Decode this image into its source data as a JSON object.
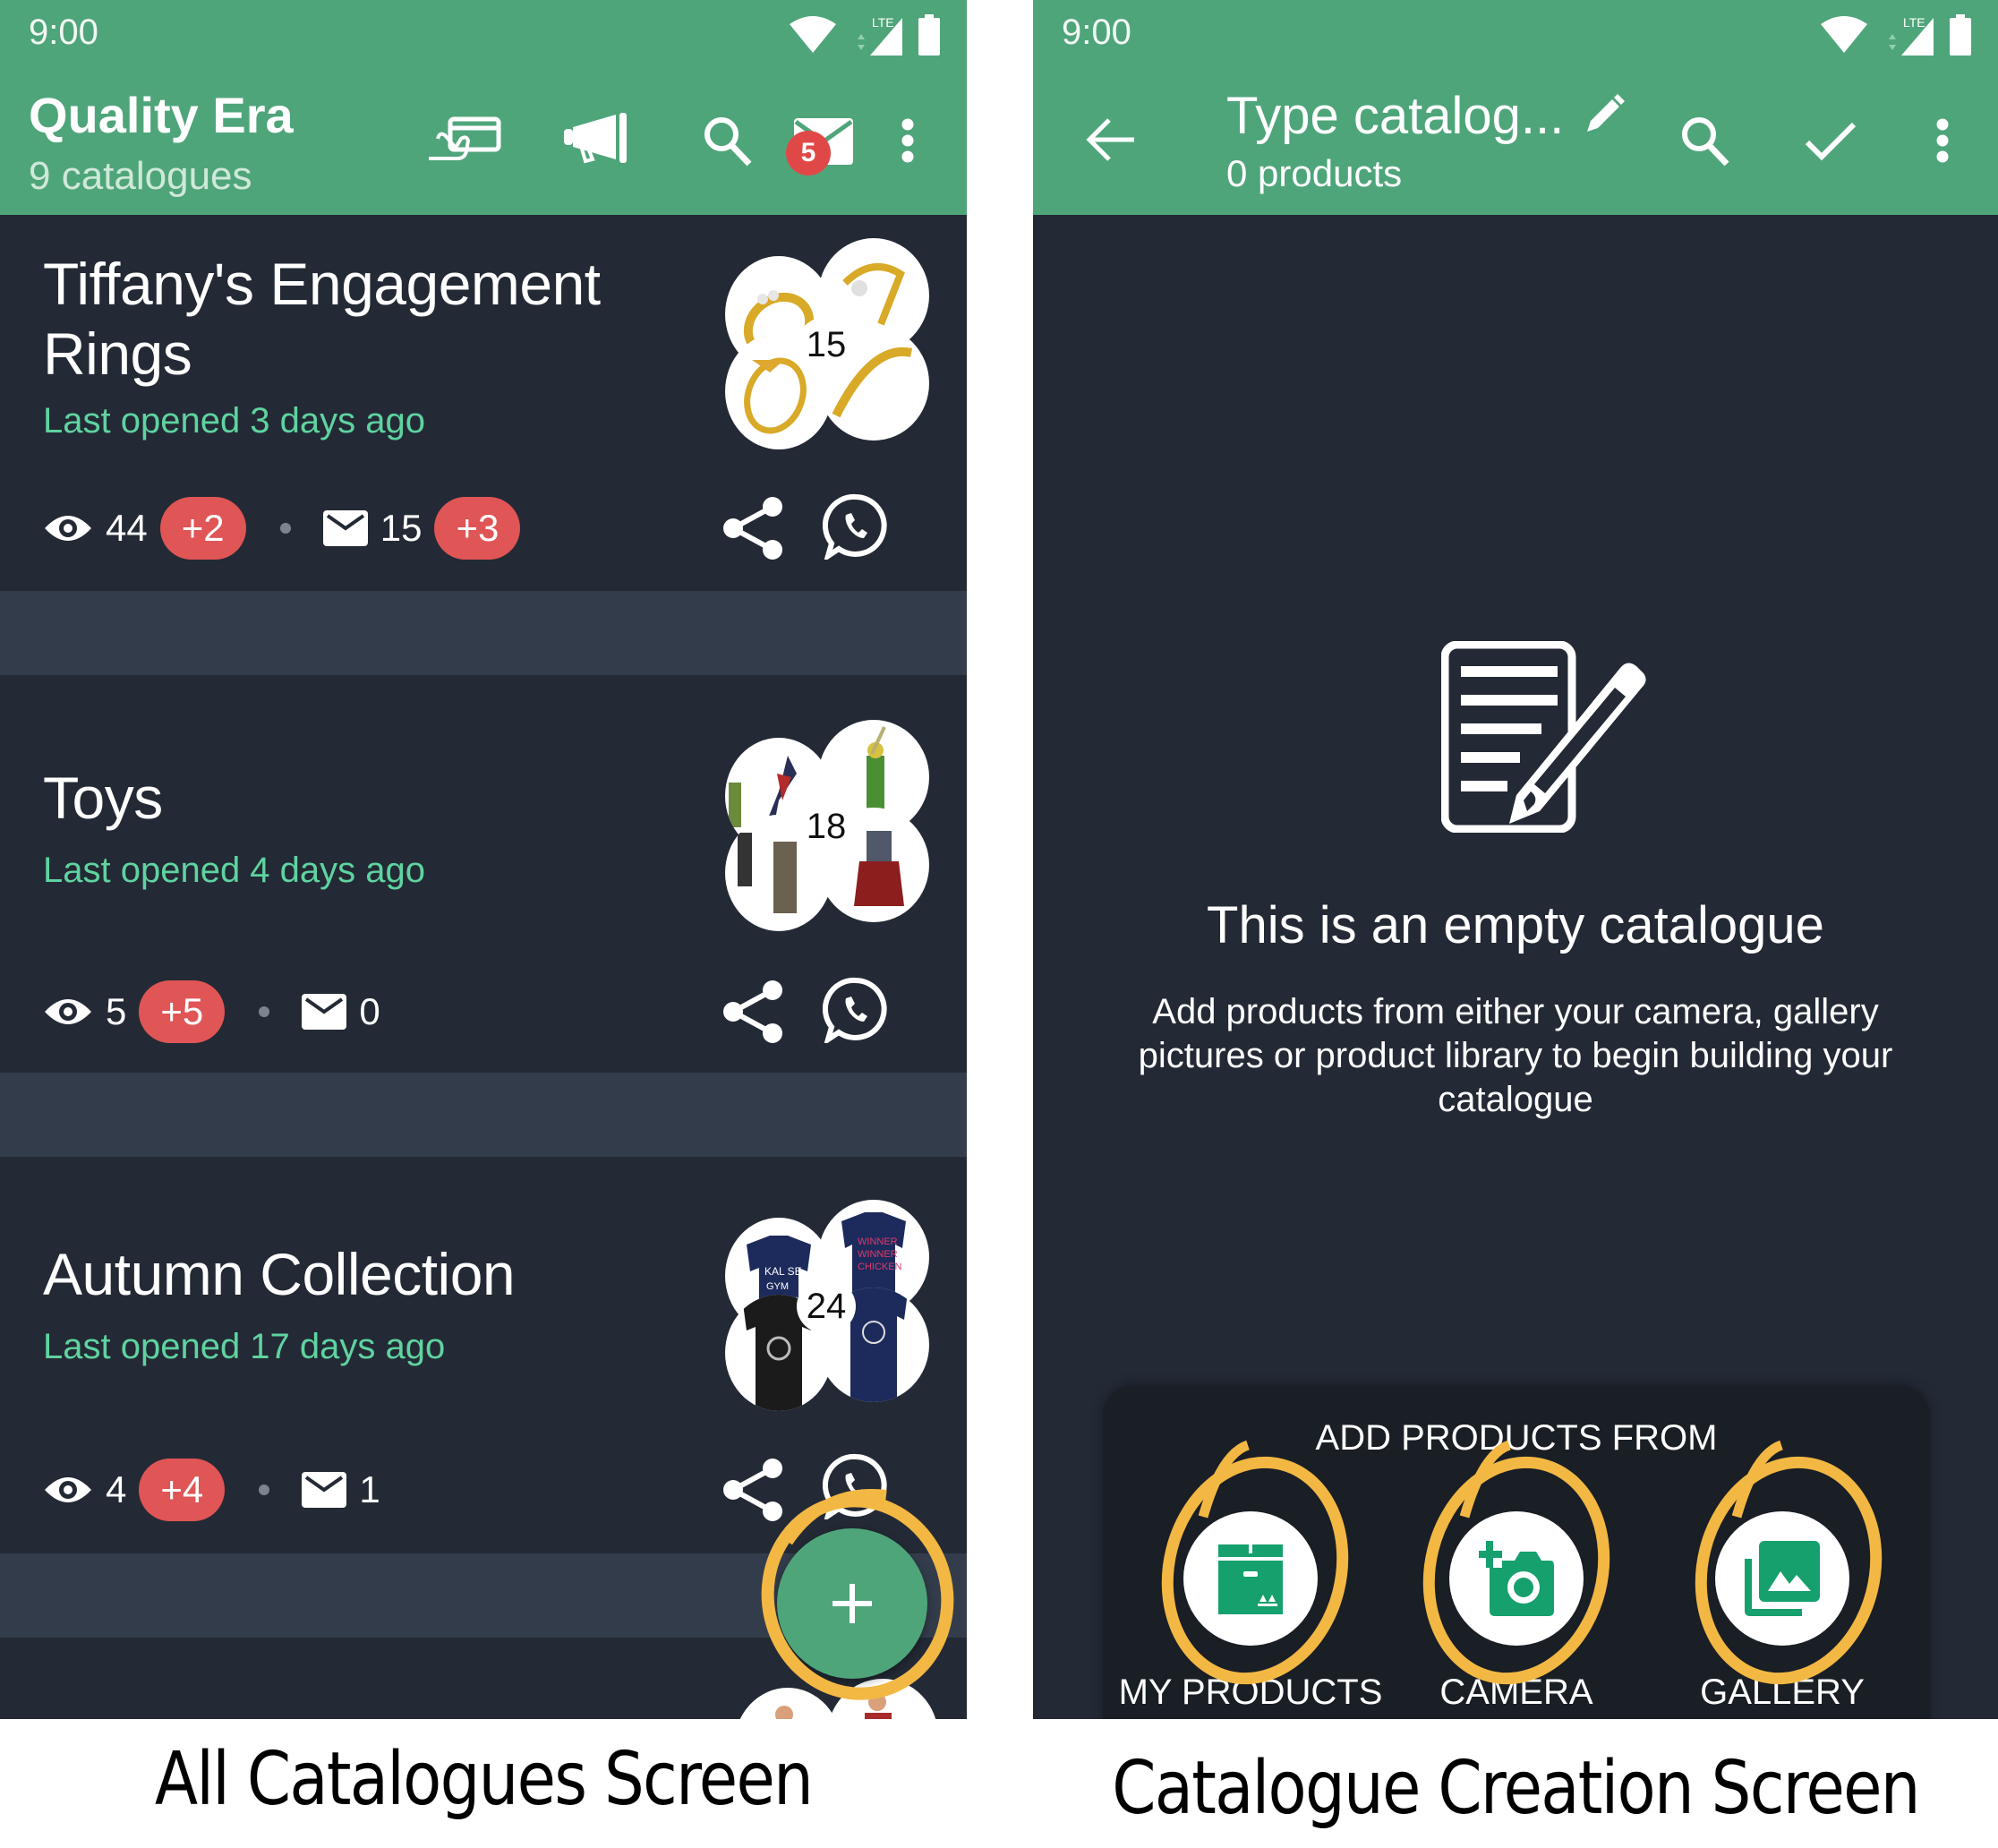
{
  "colors": {
    "brand_green": "#4fa57a",
    "card_background": "#232a35",
    "separator": "#333c4b",
    "accent_text_green": "#5fd3a0",
    "delta_badge_red": "#e05555",
    "highlight_yellow": "#f2b843",
    "sheet_background": "#1a1e25"
  },
  "left_screen": {
    "status_bar": {
      "time": "9:00",
      "network_label": "LTE",
      "icons": [
        "wifi-icon",
        "signal-icon",
        "battery-icon"
      ]
    },
    "app_bar": {
      "title": "Quality Era",
      "subtitle": "9 catalogues",
      "actions": [
        {
          "name": "payment-card-icon",
          "label": "Payments"
        },
        {
          "name": "megaphone-icon",
          "label": "Broadcast"
        },
        {
          "name": "search-icon",
          "label": "Search"
        },
        {
          "name": "inbox-icon",
          "label": "Messages",
          "badge": "5"
        },
        {
          "name": "more-vert-icon",
          "label": "More options"
        }
      ]
    },
    "catalogues": [
      {
        "title": "Tiffany's Engagement Rings",
        "last_opened": "Last opened 3 days ago",
        "product_count": "15",
        "views": "44",
        "views_delta": "+2",
        "messages": "15",
        "messages_delta": "+3",
        "thumbnails": [
          "gold-ring-diamond-band",
          "gold-ring-flower-cluster",
          "gold-ring-v-setting",
          "gold-ring-slim-band"
        ]
      },
      {
        "title": "Toys",
        "last_opened": "Last opened 4 days ago",
        "product_count": "18",
        "views": "5",
        "views_delta": "+5",
        "messages": "0",
        "messages_delta": null,
        "thumbnails": [
          "action-figure-spiderman",
          "action-figure-loki",
          "action-figure-soldier",
          "action-figure-thor"
        ]
      },
      {
        "title": "Autumn Collection",
        "last_opened": "Last opened 17 days ago",
        "product_count": "24",
        "views": "4",
        "views_delta": "+4",
        "messages": "1",
        "messages_delta": null,
        "thumbnails": [
          "tshirt-kal-se-gym-chalu",
          "tshirt-winner-winner",
          "tshirt-black-camera",
          "tshirt-navy-print"
        ]
      }
    ],
    "fab": {
      "icon": "plus-icon",
      "label": "Create catalogue"
    }
  },
  "right_screen": {
    "status_bar": {
      "time": "9:00",
      "network_label": "LTE"
    },
    "app_bar": {
      "title": "Type catalog...",
      "subtitle": "0 products",
      "actions": [
        {
          "name": "back-arrow-icon",
          "label": "Back"
        },
        {
          "name": "edit-pencil-icon",
          "label": "Edit name"
        },
        {
          "name": "search-icon",
          "label": "Search"
        },
        {
          "name": "check-icon",
          "label": "Done"
        },
        {
          "name": "more-vert-icon",
          "label": "More options"
        }
      ]
    },
    "empty_state": {
      "icon": "document-edit-icon",
      "title": "This is an empty catalogue",
      "description": "Add products from either your camera, gallery pictures or product library to begin building your catalogue"
    },
    "add_sheet": {
      "title": "ADD PRODUCTS FROM",
      "options": [
        {
          "label": "MY PRODUCTS",
          "icon": "box-icon"
        },
        {
          "label": "CAMERA",
          "icon": "add-camera-icon"
        },
        {
          "label": "GALLERY",
          "icon": "photo-library-icon"
        }
      ]
    }
  },
  "captions": {
    "left": "All Catalogues Screen",
    "right": "Catalogue Creation Screen"
  }
}
